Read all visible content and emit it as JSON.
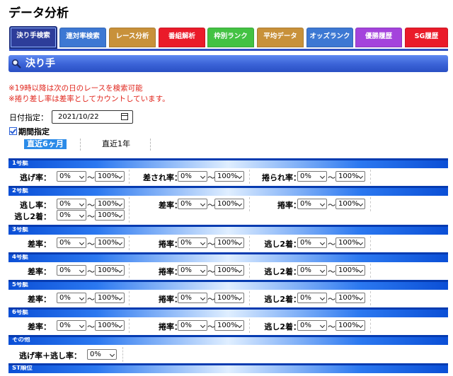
{
  "page": {
    "title": "データ分析"
  },
  "tabs": [
    {
      "label": "決り手検索",
      "color": "#2d3d9a",
      "active": true
    },
    {
      "label": "連対率検索",
      "color": "#3d78d3"
    },
    {
      "label": "レース分析",
      "color": "#c8913a"
    },
    {
      "label": "番組解析",
      "color": "#ea1b2a"
    },
    {
      "label": "枠別ランク",
      "color": "#43c243"
    },
    {
      "label": "平均データ",
      "color": "#c8913a"
    },
    {
      "label": "オッズランク",
      "color": "#3d78d3"
    },
    {
      "label": "優勝履歴",
      "color": "#a443dc"
    },
    {
      "label": "SG履歴",
      "color": "#ea1b2a"
    }
  ],
  "section": {
    "title": "決り手",
    "icon": "search-icon"
  },
  "notes": [
    "※19時以降は次の日のレースを検索可能",
    "※捲り差し率は差率としてカウントしています。"
  ],
  "date": {
    "label": "日付指定：",
    "value": "2021/10/22"
  },
  "period": {
    "label": "期間指定",
    "options": [
      "直近6ヶ月",
      "直近1年"
    ],
    "selected": "直近6ヶ月"
  },
  "range": {
    "from": "0%",
    "to": "100%",
    "separator": "〜"
  },
  "groups": [
    {
      "title": "1号艇",
      "fields": [
        "逃げ率：",
        "差され率：",
        "捲られ率："
      ]
    },
    {
      "title": "2号艇",
      "fields": [
        "逃し率：",
        "差率：",
        "捲率：",
        "逃し2着："
      ]
    },
    {
      "title": "3号艇",
      "fields": [
        "差率：",
        "捲率：",
        "逃し2着："
      ]
    },
    {
      "title": "4号艇",
      "fields": [
        "差率：",
        "捲率：",
        "逃し2着："
      ]
    },
    {
      "title": "5号艇",
      "fields": [
        "差率：",
        "捲率：",
        "逃し2着："
      ]
    },
    {
      "title": "6号艇",
      "fields": [
        "差率：",
        "捲率：",
        "逃し2着："
      ]
    },
    {
      "title": "その他",
      "fields": [
        "逃げ率＋逃し率："
      ],
      "single_value": "0%"
    },
    {
      "title": "ST順位"
    }
  ]
}
